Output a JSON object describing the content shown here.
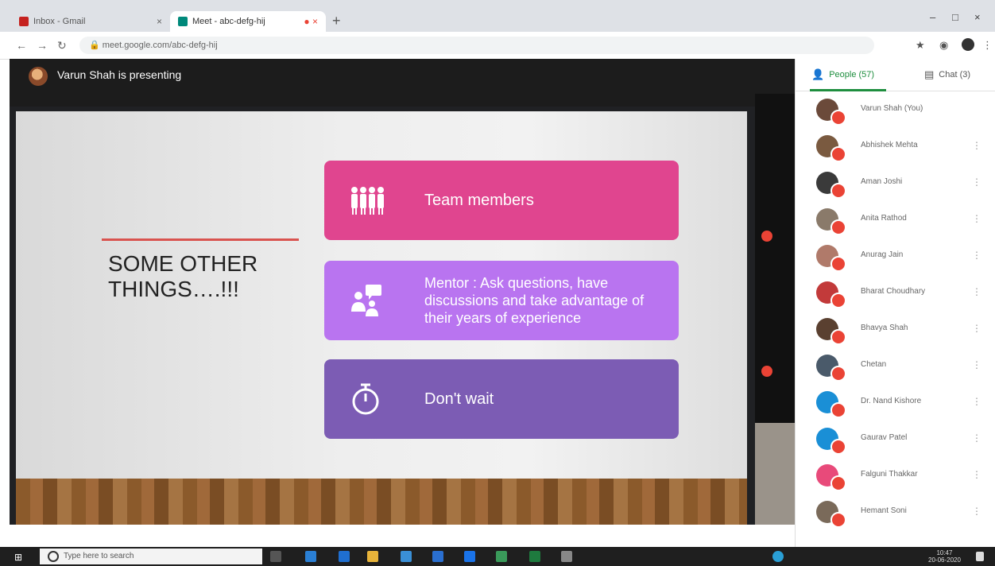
{
  "browser": {
    "tabs": [
      {
        "title": "Inbox - Gmail",
        "active": false
      },
      {
        "title": "Meet - abc-defg-hij",
        "active": true
      }
    ],
    "url": "meet.google.com/abc-defg-hij",
    "new_tab_symbol": "+",
    "window_controls": [
      "–",
      "□",
      "×"
    ]
  },
  "meet": {
    "presenting_label": "Varun Shah is presenting",
    "slide": {
      "heading": "SOME OTHER\nTHINGS….!!!",
      "cards": [
        {
          "icon": "team-members-icon",
          "text": "Team members",
          "color": "#e0458f"
        },
        {
          "icon": "mentor-icon",
          "text": "Mentor : Ask questions, have discussions and take advantage of their years of experience",
          "color": "#b974f0"
        },
        {
          "icon": "stopwatch-icon",
          "text": "Don't wait",
          "color": "#7c5cb4"
        }
      ]
    }
  },
  "panel": {
    "people_tab": "People (57)",
    "chat_tab": "Chat (3)",
    "people": [
      {
        "name": "Varun Shah (You)",
        "avatar_color": "#6b4a3a"
      },
      {
        "name": "Abhishek Mehta",
        "avatar_color": "#7a5a40"
      },
      {
        "name": "Aman Joshi",
        "avatar_color": "#3a3a3a"
      },
      {
        "name": "Anita Rathod",
        "avatar_color": "#8a7a6a"
      },
      {
        "name": "Anurag Jain",
        "avatar_color": "#b07a6a"
      },
      {
        "name": "Bharat Choudhary",
        "avatar_color": "#c23a3a"
      },
      {
        "name": "Bhavya Shah",
        "avatar_color": "#5a4030"
      },
      {
        "name": "Chetan",
        "avatar_color": "#4a5a6a"
      },
      {
        "name": "Dr. Nand Kishore",
        "avatar_color": "#1a8fd6"
      },
      {
        "name": "Gaurav Patel",
        "avatar_color": "#1a8fd6"
      },
      {
        "name": "Falguni Thakkar",
        "avatar_color": "#e84a7a"
      },
      {
        "name": "Hemant Soni",
        "avatar_color": "#7a6a5a"
      }
    ],
    "more_symbol": "⋮"
  },
  "taskbar": {
    "search_placeholder": "Type here to search",
    "clock_time": "10:47",
    "clock_date": "20-06-2020"
  },
  "colors": {
    "team": "#e0458f",
    "mentor": "#b974f0",
    "wait": "#7c5cb4",
    "badge": "#ea4335",
    "meet_green": "#1e8e3e"
  }
}
